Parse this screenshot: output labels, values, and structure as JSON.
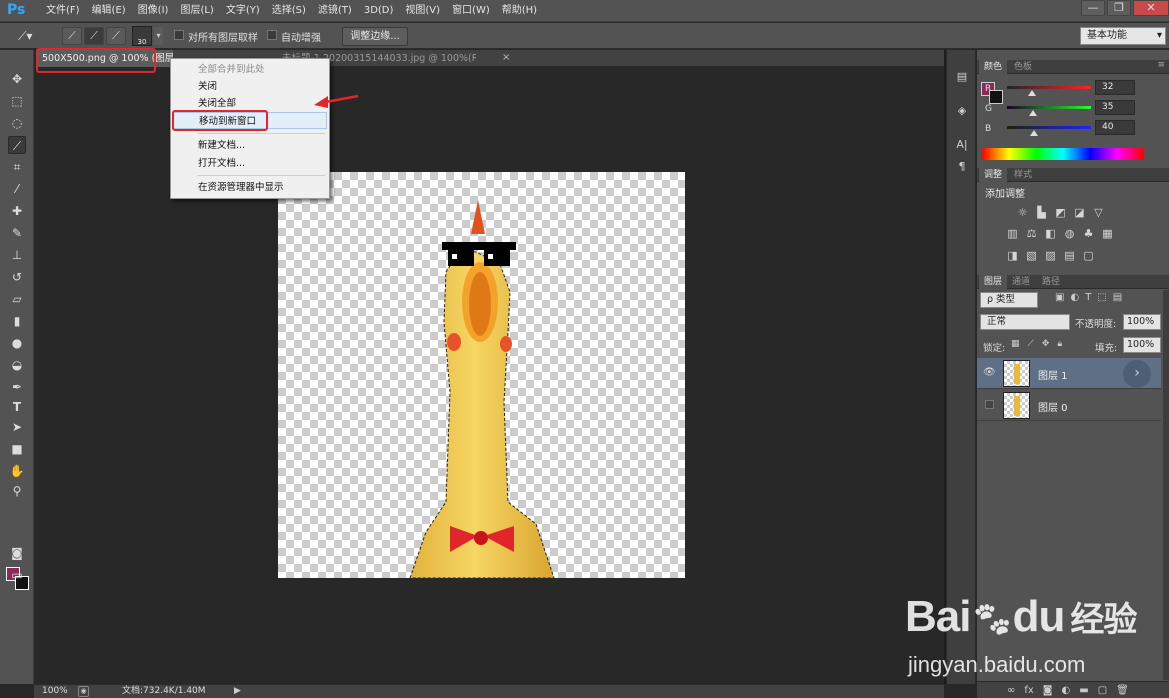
{
  "app": {
    "logo": "Ps"
  },
  "menubar": {
    "items": [
      "文件(F)",
      "编辑(E)",
      "图像(I)",
      "图层(L)",
      "文字(Y)",
      "选择(S)",
      "滤镜(T)",
      "3D(D)",
      "视图(V)",
      "窗口(W)",
      "帮助(H)"
    ],
    "window_controls": {
      "minimize": "—",
      "restore": "❐",
      "close": "✕"
    }
  },
  "options": {
    "brush_size": "30",
    "sample_all_layers": "对所有图层取样",
    "auto_enhance": "自动增强",
    "refine_edge": "调整边缘...",
    "workspace": "基本功能"
  },
  "tabs": {
    "tab1": "500X500.png @ 100% (图层 1, RGB/8)",
    "tab2": "未标题-1 20200315144033.jpg @ 100%(RGB/8#)",
    "close_glyph": "×"
  },
  "context_menu": {
    "items": [
      {
        "label": "全部合并到此处",
        "disabled": true
      },
      {
        "label": "关闭",
        "disabled": false
      },
      {
        "label": "关闭全部",
        "disabled": false
      },
      {
        "label": "移动到新窗口",
        "disabled": false,
        "highlighted": true
      },
      {
        "label": "新建文档...",
        "disabled": false
      },
      {
        "label": "打开文档...",
        "disabled": false
      },
      {
        "label": "在资源管理器中显示",
        "disabled": false
      }
    ]
  },
  "status": {
    "zoom": "100%",
    "doc_info": "文档:732.4K/1.40M"
  },
  "color_panel": {
    "tabs": [
      "颜色",
      "色板"
    ],
    "channels": [
      {
        "label": "R",
        "value": "32",
        "level": 0.125
      },
      {
        "label": "G",
        "value": "35",
        "level": 0.137
      },
      {
        "label": "B",
        "value": "40",
        "level": 0.157
      }
    ],
    "foreground": "#8a2b55",
    "background": "#111111"
  },
  "adjust_panel": {
    "tabs": [
      "调整",
      "样式"
    ],
    "title": "添加调整"
  },
  "layers_panel": {
    "tabs": [
      "图层",
      "通道",
      "路径"
    ],
    "filter_type": "ρ 类型",
    "blend_mode": "正常",
    "opacity_label": "不透明度:",
    "opacity_value": "100%",
    "lock_label": "锁定:",
    "fill_label": "填充:",
    "fill_value": "100%",
    "layers": [
      {
        "name": "图层 1",
        "visible": true,
        "selected": true
      },
      {
        "name": "图层 0",
        "visible": false,
        "selected": false
      }
    ]
  },
  "watermark": {
    "brand": "Bai",
    "brand2": "du",
    "cn": "经验",
    "url": "jingyan.baidu.com"
  }
}
